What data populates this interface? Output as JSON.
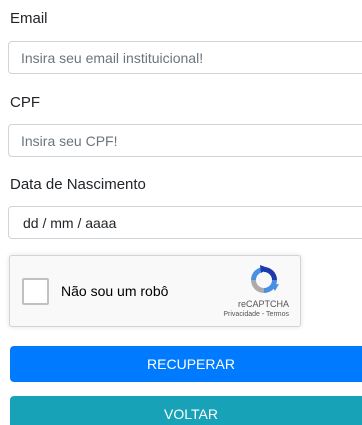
{
  "form": {
    "email": {
      "label": "Email",
      "placeholder": "Insira seu email instituicional!"
    },
    "cpf": {
      "label": "CPF",
      "placeholder": "Insira seu CPF!"
    },
    "birthdate": {
      "label": "Data de Nascimento",
      "value": "dd / mm / aaaa"
    },
    "recaptcha": {
      "checkbox_label": "Não sou um robô",
      "brand": "reCAPTCHA",
      "links": "Privacidade - Termos",
      "icon": "recaptcha-logo-icon"
    },
    "buttons": {
      "recover": "RECUPERAR",
      "back": "VOLTAR"
    }
  },
  "colors": {
    "primary": "#007bff",
    "info": "#17a2b8",
    "border": "#ced4da",
    "placeholder": "#6c757d"
  }
}
